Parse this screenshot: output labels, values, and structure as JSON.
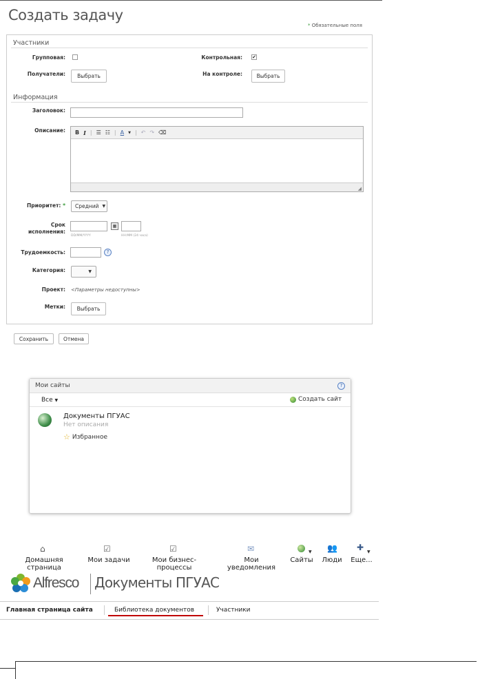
{
  "form": {
    "title": "Создать задачу",
    "required_note": "Обязательные поля",
    "required_star": "*",
    "participants_section": "Участники",
    "group_label": "Групповая:",
    "control_label": "Контрольная:",
    "recipients_label": "Получатели:",
    "recipients_button": "Выбрать",
    "on_control_label": "На контроле:",
    "on_control_button": "Выбрать",
    "info_section": "Информация",
    "heading_label": "Заголовок:",
    "description_label": "Описание:",
    "priority_label": "Приоритет:",
    "priority_value": "Средний",
    "due_label_1": "Срок",
    "due_label_2": "исполнения:",
    "date_hint": "DD/MM/YYYY",
    "time_hint": "HH:MM (24 часа)",
    "effort_label": "Трудоемкость:",
    "category_label": "Категория:",
    "project_label": "Проект:",
    "project_value": "<Параметры недоступны>",
    "tags_label": "Метки:",
    "tags_button": "Выбрать",
    "save_button": "Сохранить",
    "cancel_button": "Отмена",
    "group_checked": false,
    "control_checked": true
  },
  "my_sites": {
    "title": "Мои сайты",
    "filter": "Все",
    "create_site": "Создать сайт",
    "site_name": "Документы ПГУАС",
    "site_desc": "Нет описания",
    "favorite": "Избранное"
  },
  "nav": {
    "items": [
      "Домашняя страница",
      "Мои задачи",
      "Мои бизнес-процессы",
      "Мои уведомления",
      "Сайты",
      "Люди",
      "Еще..."
    ]
  },
  "site_header": {
    "logo": "Alfresco",
    "site_title": "Документы ПГУАС"
  },
  "tabs": [
    "Главная страница сайта",
    "Библиотека документов",
    "Участники"
  ],
  "colors": {
    "accent_green": "#3a9a3a",
    "underline_red": "#c00000",
    "link_blue": "#3a63a4"
  }
}
